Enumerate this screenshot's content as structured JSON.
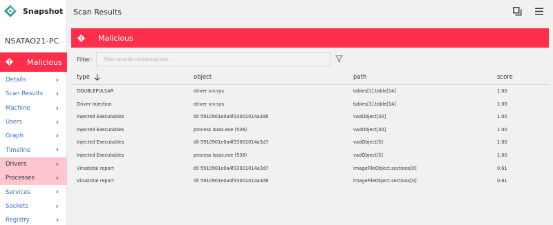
{
  "app": {
    "name": "Snapshot"
  },
  "header": {
    "title": "Scan Results"
  },
  "sidebar": {
    "hostname": "NSATAO21-PC",
    "status_label": "Malicious",
    "items": [
      {
        "label": "Details",
        "active": false
      },
      {
        "label": "Scan Results",
        "active": false
      },
      {
        "label": "Machine",
        "active": false
      },
      {
        "label": "Users",
        "active": false
      },
      {
        "label": "Graph",
        "active": false
      },
      {
        "label": "Timeline",
        "active": false
      },
      {
        "label": "Drivers",
        "active": true
      },
      {
        "label": "Processes",
        "active": true
      },
      {
        "label": "Services",
        "active": false
      },
      {
        "label": "Sockets",
        "active": false
      },
      {
        "label": "Registry",
        "active": false
      }
    ],
    "chevron": "›"
  },
  "banner": {
    "label": "Malicious"
  },
  "filter": {
    "label": "Filter:",
    "placeholder": "Filter records containing text ...",
    "value": ""
  },
  "table": {
    "columns": [
      "type",
      "object",
      "path",
      "score"
    ],
    "rows": [
      [
        "DOUBLEPULSAR",
        "driver srv.sys",
        "tables[1].table[14]",
        "1.00"
      ],
      [
        "Driver Injection",
        "driver srv.sys",
        "tables[1].table[14]",
        "1.00"
      ],
      [
        "Injected Executables",
        "dll 5910901e0a4f33001014a3d8",
        "vadObject[30]",
        "1.00"
      ],
      [
        "Injected Executables",
        "process lsass.exe (536)",
        "vadObject[30]",
        "1.00"
      ],
      [
        "Injected Executables",
        "dll 5910901e0a4f33001014a3d7",
        "vadObject[5]",
        "1.00"
      ],
      [
        "Injected Executables",
        "process lsass.exe (536)",
        "vadObject[5]",
        "1.00"
      ],
      [
        "Virustotal report",
        "dll 5910901e0a4f33001014a3d7",
        "imageFileObject.sections[0]",
        "0.61"
      ],
      [
        "Virustotal report",
        "dll 5910901e0a4f33001014a3d8",
        "imageFileObject.sections[0]",
        "0.61"
      ]
    ]
  },
  "colors": {
    "accent": "#ff2f4c",
    "active_nav": "#ffc6cf",
    "link": "#3a6fb8",
    "logo": "#2e9a8e"
  },
  "icons": {
    "logo": "snapshot-logo-icon",
    "status": "diamond-alert-icon",
    "windows": "windows-icon",
    "menu": "hamburger-menu-icon",
    "filter": "funnel-icon",
    "sort": "arrow-down-icon"
  }
}
